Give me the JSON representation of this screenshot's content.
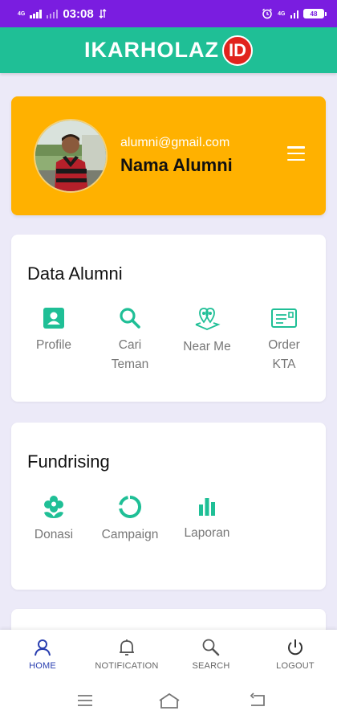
{
  "status_bar": {
    "net_badge": "4G",
    "time": "03:08",
    "battery": "48",
    "net_badge_right": "4G"
  },
  "app_bar": {
    "brand": "IKARHOLAZ",
    "badge": "ID"
  },
  "profile": {
    "email": "alumni@gmail.com",
    "name": "Nama Alumni",
    "menu_icon": "hamburger-icon"
  },
  "data_alumni": {
    "title": "Data Alumni",
    "items": [
      {
        "label": "Profile",
        "icon": "profile-card-icon"
      },
      {
        "label": "Cari Teman",
        "icon": "search-icon"
      },
      {
        "label": "Near Me",
        "icon": "map-pin-icon"
      },
      {
        "label": "Order KTA",
        "icon": "id-card-icon"
      }
    ]
  },
  "fundrising": {
    "title": "Fundrising",
    "items": [
      {
        "label": "Donasi",
        "icon": "flower-icon"
      },
      {
        "label": "Campaign",
        "icon": "ring-icon"
      },
      {
        "label": "Laporan",
        "icon": "bar-chart-icon"
      }
    ]
  },
  "bottom_nav": [
    {
      "label": "HOME",
      "icon": "user-icon",
      "active": true
    },
    {
      "label": "NOTIFICATION",
      "icon": "bell-icon",
      "active": false
    },
    {
      "label": "SEARCH",
      "icon": "search-icon",
      "active": false
    },
    {
      "label": "LOGOUT",
      "icon": "power-icon",
      "active": false
    }
  ],
  "colors": {
    "status_bar": "#7a1de0",
    "app_bar": "#1fbf96",
    "profile_card": "#ffb100",
    "icon_accent": "#1fbf96",
    "brand_badge": "#e1231d",
    "nav_active": "#2a3fb0",
    "background": "#eceaf8"
  }
}
